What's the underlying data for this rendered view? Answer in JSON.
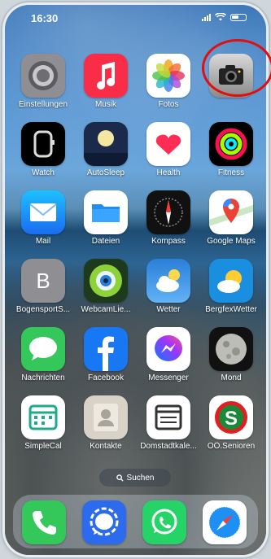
{
  "status_bar": {
    "time": "16:30"
  },
  "apps": [
    {
      "label": "Einstellungen",
      "icon": "settings-gear-icon",
      "color": "#8e8e93"
    },
    {
      "label": "Musik",
      "icon": "music-note-icon",
      "color": "#fa2d48"
    },
    {
      "label": "Fotos",
      "icon": "photos-flower-icon",
      "color": "#ffffff"
    },
    {
      "label": "",
      "icon": "camera-icon",
      "color": "#9a9a9a"
    },
    {
      "label": "Watch",
      "icon": "watch-icon",
      "color": "#000000"
    },
    {
      "label": "AutoSleep",
      "icon": "moon-icon",
      "color": "#1b2a4a"
    },
    {
      "label": "Health",
      "icon": "heart-icon",
      "color": "#ffffff"
    },
    {
      "label": "Fitness",
      "icon": "activity-rings-icon",
      "color": "#000000"
    },
    {
      "label": "Mail",
      "icon": "mail-envelope-icon",
      "color": "#1e7cf2"
    },
    {
      "label": "Dateien",
      "icon": "folder-icon",
      "color": "#ffffff"
    },
    {
      "label": "Kompass",
      "icon": "compass-icon",
      "color": "#111111"
    },
    {
      "label": "Google Maps",
      "icon": "map-pin-icon",
      "color": "#ffffff"
    },
    {
      "label": "BogensportS...",
      "icon": "letter-b-icon",
      "color": "#8e8e93"
    },
    {
      "label": "WebcamLie...",
      "icon": "webcam-eye-icon",
      "color": "#2a5a2a"
    },
    {
      "label": "Wetter",
      "icon": "weather-cloud-icon",
      "color": "#3a8ee6"
    },
    {
      "label": "BergfexWetter",
      "icon": "sun-cloud-icon",
      "color": "#1a8fe0"
    },
    {
      "label": "Nachrichten",
      "icon": "message-bubble-icon",
      "color": "#34c759"
    },
    {
      "label": "Facebook",
      "icon": "facebook-f-icon",
      "color": "#1877f2"
    },
    {
      "label": "Messenger",
      "icon": "messenger-bolt-icon",
      "color": "#ffffff"
    },
    {
      "label": "Mond",
      "icon": "moon-photo-icon",
      "color": "#222222"
    },
    {
      "label": "SimpleCal",
      "icon": "calendar-icon",
      "color": "#ffffff"
    },
    {
      "label": "Kontakte",
      "icon": "contacts-person-icon",
      "color": "#d9d2c6"
    },
    {
      "label": "Domstadtkale...",
      "icon": "calendar-list-icon",
      "color": "#ffffff"
    },
    {
      "label": "OÖ.Senioren",
      "icon": "s-logo-icon",
      "color": "#ffffff"
    }
  ],
  "search": {
    "label": "Suchen"
  },
  "dock": [
    {
      "icon": "phone-icon",
      "color": "#34c759"
    },
    {
      "icon": "signal-chat-icon",
      "color": "#2c6bed"
    },
    {
      "icon": "whatsapp-icon",
      "color": "#25d366"
    },
    {
      "icon": "safari-compass-icon",
      "color": "#ffffff"
    }
  ],
  "annotation": {
    "color": "#e01010"
  }
}
